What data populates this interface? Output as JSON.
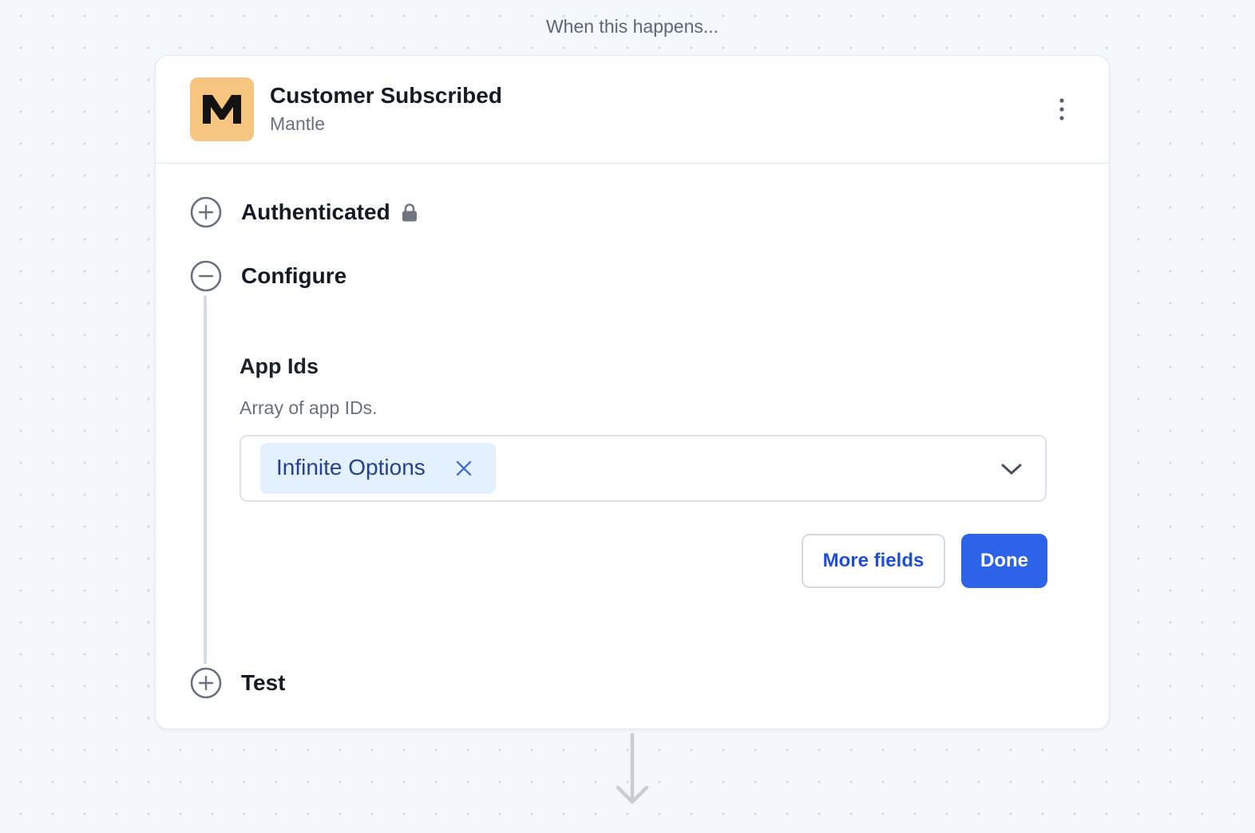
{
  "canvas": {
    "trigger_heading": "When this happens..."
  },
  "trigger": {
    "title": "Customer Subscribed",
    "app_name": "Mantle",
    "logo_letter": "M",
    "logo_color": "#f6c57f",
    "menu_icon": "kebab-icon"
  },
  "steps": [
    {
      "label": "Authenticated",
      "state": "collapsed",
      "icon": "plus-circle-icon",
      "badge_icon": "lock-icon"
    },
    {
      "label": "Configure",
      "state": "expanded",
      "icon": "minus-circle-icon"
    },
    {
      "label": "Test",
      "state": "collapsed",
      "icon": "plus-circle-icon"
    }
  ],
  "configure": {
    "field": {
      "label": "App Ids",
      "description": "Array of app IDs.",
      "selected": [
        {
          "label": "Infinite Options",
          "remove_icon": "close-icon"
        }
      ],
      "dropdown_icon": "chevron-down-icon"
    },
    "more_fields_label": "More fields",
    "done_label": "Done"
  },
  "colors": {
    "primary": "#2d63e8",
    "chip_background": "#e3f0fd",
    "chip_text": "#25408f",
    "link_text": "#1f4fd6"
  }
}
